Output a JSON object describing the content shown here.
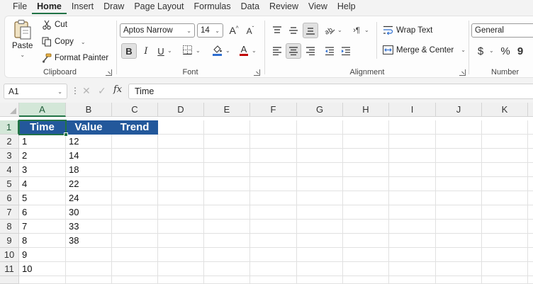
{
  "menu": {
    "tabs": [
      "File",
      "Home",
      "Insert",
      "Draw",
      "Page Layout",
      "Formulas",
      "Data",
      "Review",
      "View",
      "Help"
    ],
    "active": "Home"
  },
  "ribbon": {
    "clipboard": {
      "label": "Clipboard",
      "paste": "Paste",
      "cut": "Cut",
      "copy": "Copy",
      "format_painter": "Format Painter"
    },
    "font": {
      "label": "Font",
      "font_name": "Aptos Narrow",
      "font_size": "14",
      "grow": "A",
      "shrink": "A",
      "bold": "B",
      "italic": "I",
      "underline": "U",
      "font_color_letter": "A"
    },
    "alignment": {
      "label": "Alignment",
      "wrap_text": "Wrap Text",
      "merge_center": "Merge & Center"
    },
    "number": {
      "label": "Number",
      "format": "General",
      "currency": "$",
      "percent": "%",
      "comma": "9"
    }
  },
  "formula_bar": {
    "name_box": "A1",
    "fx": "fx",
    "content": "Time"
  },
  "grid": {
    "columns": [
      "A",
      "B",
      "C",
      "D",
      "E",
      "F",
      "G",
      "H",
      "I",
      "J",
      "K"
    ],
    "rows": [
      "1",
      "2",
      "3",
      "4",
      "5",
      "6",
      "7",
      "8",
      "9",
      "10",
      "11"
    ],
    "header_row": [
      "Time",
      "Value",
      "Trend"
    ],
    "data": [
      [
        "1",
        "12"
      ],
      [
        "2",
        "14"
      ],
      [
        "3",
        "18"
      ],
      [
        "4",
        "22"
      ],
      [
        "5",
        "24"
      ],
      [
        "6",
        "30"
      ],
      [
        "7",
        "33"
      ],
      [
        "8",
        "38"
      ],
      [
        "9",
        ""
      ],
      [
        "10",
        ""
      ]
    ]
  },
  "colors": {
    "accent": "#217346",
    "header_fill": "#23589b"
  }
}
